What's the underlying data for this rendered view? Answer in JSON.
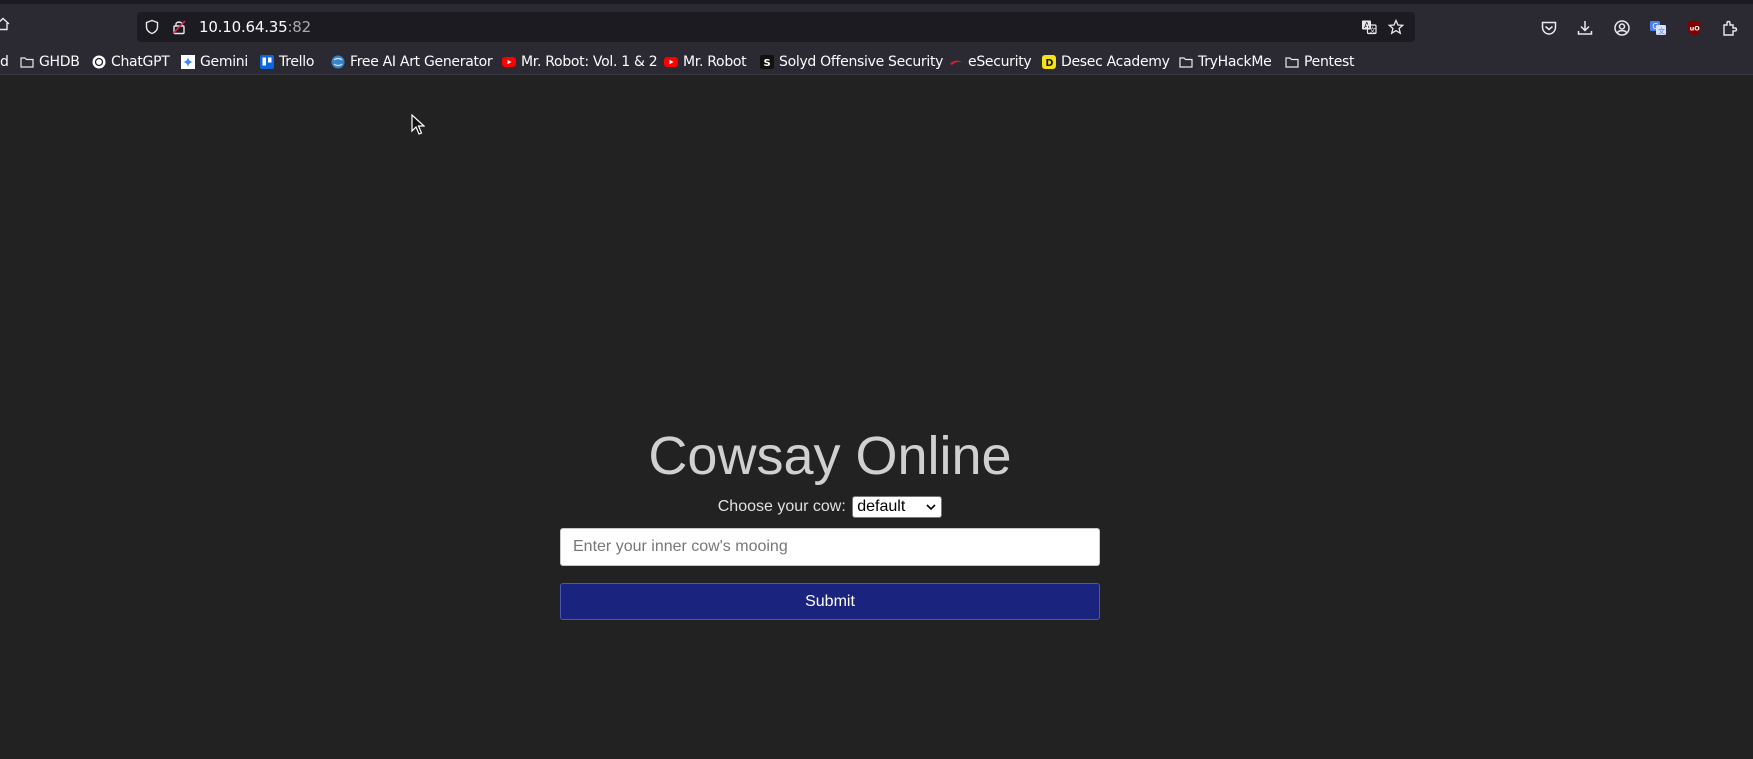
{
  "browser": {
    "url_host": "10.10.64.35",
    "url_port": ":82"
  },
  "bookmarks": [
    {
      "label": "d",
      "icon": "none"
    },
    {
      "label": "GHDB",
      "icon": "folder-icon"
    },
    {
      "label": "ChatGPT",
      "icon": "chatgpt-icon"
    },
    {
      "label": "Gemini",
      "icon": "gemini-icon"
    },
    {
      "label": "Trello",
      "icon": "trello-icon"
    },
    {
      "label": "Free AI Art Generator",
      "icon": "globe-icon"
    },
    {
      "label": "Mr. Robot: Vol. 1 & 2",
      "icon": "youtube-icon"
    },
    {
      "label": "Mr. Robot",
      "icon": "youtube-icon"
    },
    {
      "label": "Solyd Offensive Security",
      "icon": "solyd-icon"
    },
    {
      "label": "eSecurity",
      "icon": "esecurity-icon"
    },
    {
      "label": "Desec Academy",
      "icon": "desec-icon"
    },
    {
      "label": "TryHackMe",
      "icon": "folder-icon"
    },
    {
      "label": "Pentest",
      "icon": "folder-icon"
    }
  ],
  "page": {
    "title": "Cowsay Online",
    "choose_label": "Choose your cow:",
    "cow_selected": "default",
    "input_placeholder": "Enter your inner cow's mooing",
    "submit_label": "Submit"
  },
  "colors": {
    "background": "#222222",
    "submit": "#1a237e"
  }
}
